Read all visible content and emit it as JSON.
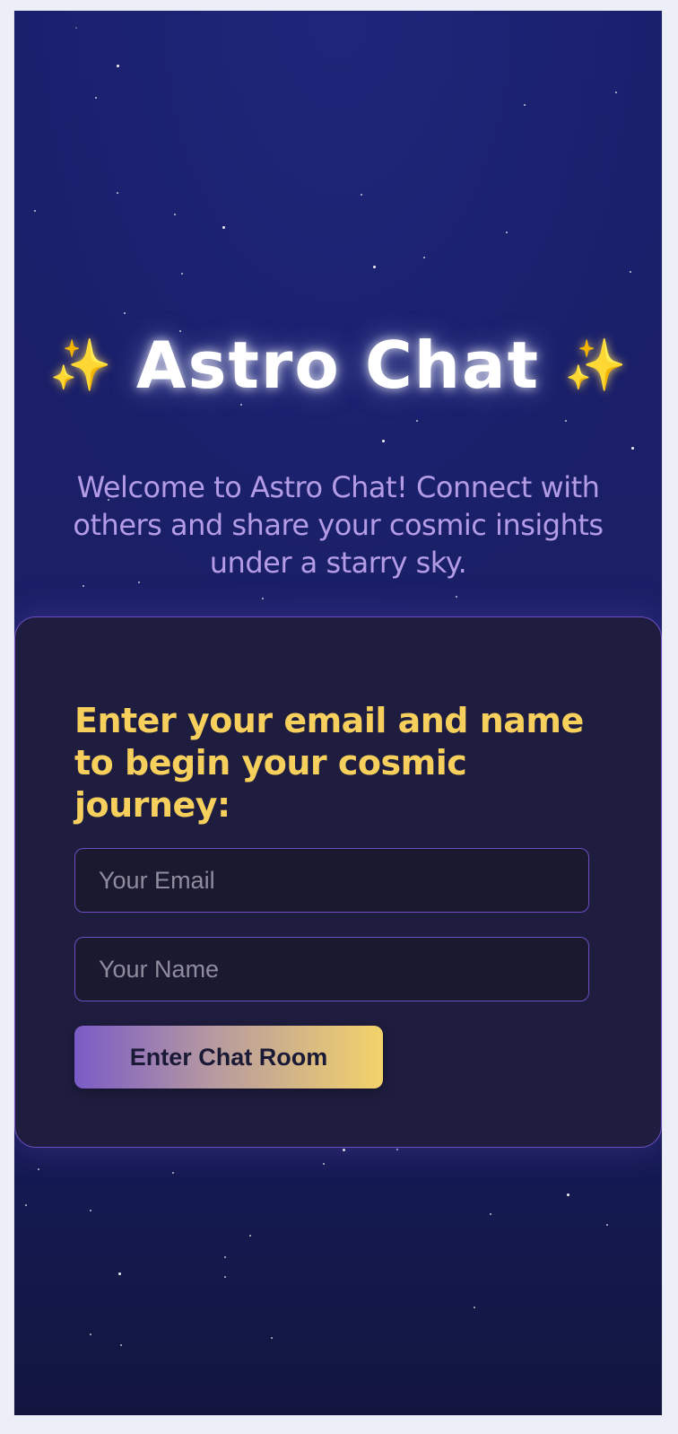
{
  "header": {
    "title": "Astro Chat",
    "sparkle_left": "✨",
    "sparkle_right": "✨",
    "subtitle": "Welcome to Astro Chat! Connect with others and share your cosmic insights under a starry sky."
  },
  "form": {
    "heading": "Enter your email and name to begin your cosmic journey:",
    "email_placeholder": "Your Email",
    "email_value": "",
    "name_placeholder": "Your Name",
    "name_value": "",
    "submit_label": "Enter Chat Room"
  },
  "colors": {
    "background": "#1a1f6b",
    "card": "#1e1d3f",
    "accent_purple": "#6b4fc0",
    "accent_gold": "#f6cf5c",
    "subtitle": "#b49be6"
  }
}
